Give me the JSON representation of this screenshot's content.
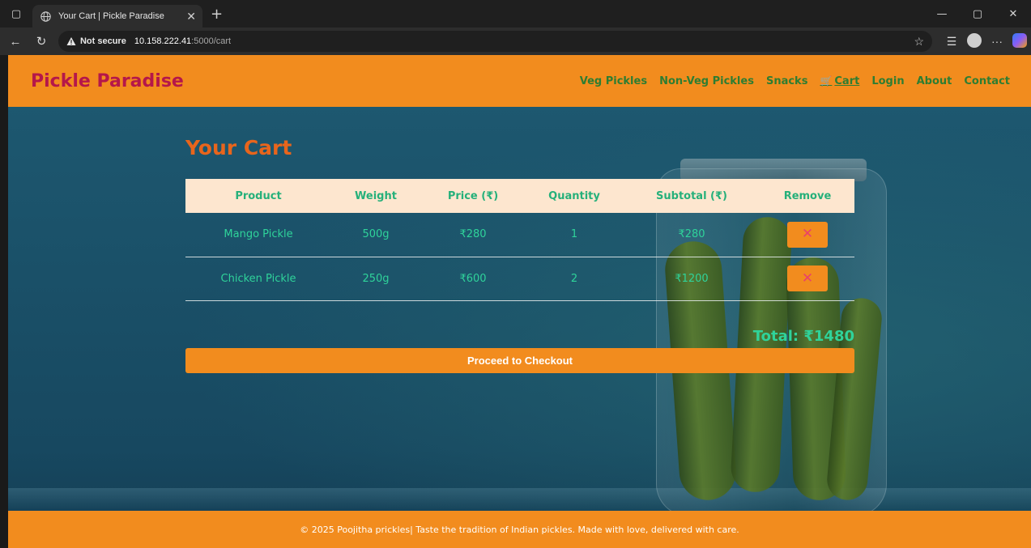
{
  "browser": {
    "tab_title": "Your Cart | Pickle Paradise",
    "not_secure_label": "Not secure",
    "url_host": "10.158.222.41",
    "url_path": ":5000/cart"
  },
  "header": {
    "brand": "Pickle Paradise",
    "nav": {
      "veg": "Veg Pickles",
      "nonveg": "Non-Veg Pickles",
      "snacks": "Snacks",
      "cart": "Cart",
      "login": "Login",
      "about": "About",
      "contact": "Contact"
    }
  },
  "cart": {
    "heading": "Your Cart",
    "columns": {
      "product": "Product",
      "weight": "Weight",
      "price": "Price (₹)",
      "quantity": "Quantity",
      "subtotal": "Subtotal (₹)",
      "remove": "Remove"
    },
    "rows": [
      {
        "product": "Mango Pickle",
        "weight": "500g",
        "price": "₹280",
        "quantity": "1",
        "subtotal": "₹280",
        "remove": "✕"
      },
      {
        "product": "Chicken Pickle",
        "weight": "250g",
        "price": "₹600",
        "quantity": "2",
        "subtotal": "₹1200",
        "remove": "✕"
      }
    ],
    "total": "Total: ₹1480",
    "checkout_label": "Proceed to Checkout"
  },
  "footer": {
    "text": "© 2025 Poojitha prickles| Taste the tradition of Indian pickles. Made with love, delivered with care."
  },
  "colors": {
    "header_bg": "#f28c1e",
    "brand": "#b5174a",
    "nav_text": "#2e7d32",
    "heading": "#e8651c",
    "table_text": "#2fd39a",
    "table_header_bg": "#fde6cf",
    "remove_x": "#e9416b"
  },
  "icons": {
    "tab": "globe-icon",
    "warning": "warning-icon",
    "cart_link": "cart-icon",
    "remove": "x-icon"
  }
}
